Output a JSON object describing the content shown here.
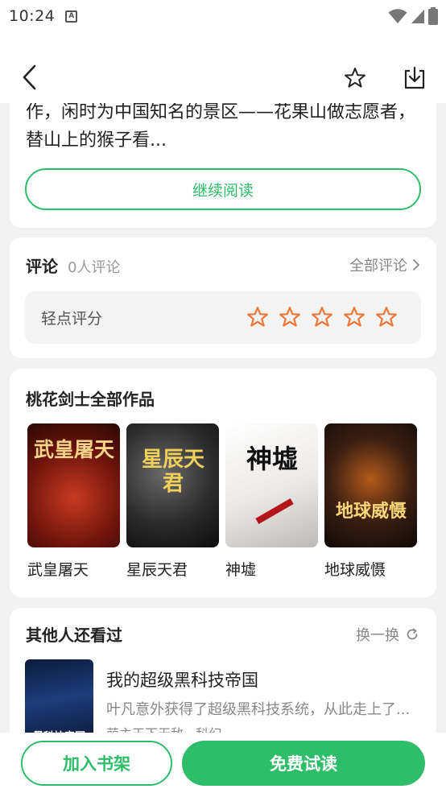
{
  "status_bar": {
    "time": "10:24",
    "notification_icon_letter": "A"
  },
  "intro": {
    "text": "作，闲时为中国知名的景区——花果山做志愿者，替山上的猴子看...",
    "continue_label": "继续阅读"
  },
  "comments": {
    "title": "评论",
    "count": "0人评论",
    "all_label": "全部评论",
    "rating_label": "轻点评分",
    "star_count": 5,
    "star_color": "#f2763a"
  },
  "works": {
    "title": "桃花剑士全部作品",
    "books": [
      {
        "title": "武皇屠天",
        "cover_text": "武皇屠天"
      },
      {
        "title": "星辰天君",
        "cover_text": "星辰天君"
      },
      {
        "title": "神墟",
        "cover_text": "神墟"
      },
      {
        "title": "地球威慑",
        "cover_text": "地球威慑"
      }
    ]
  },
  "others": {
    "title": "其他人还看过",
    "refresh_label": "换一换",
    "item": {
      "title": "我的超级黑科技帝国",
      "description": "叶凡意外获得了超级黑科技系统，从此走上了...",
      "meta": "萌主天下无敌 · 科幻",
      "cover_text": "黑科技帝国"
    }
  },
  "bottom": {
    "add_shelf_label": "加入书架",
    "free_trial_label": "免费试读"
  },
  "colors": {
    "accent": "#2ebd68",
    "star": "#f2763a"
  }
}
